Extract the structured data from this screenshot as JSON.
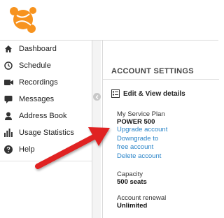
{
  "sidebar": {
    "items": [
      {
        "label": "Dashboard",
        "icon": "home-icon"
      },
      {
        "label": "Schedule",
        "icon": "clock-icon"
      },
      {
        "label": "Recordings",
        "icon": "video-camera-icon"
      },
      {
        "label": "Messages",
        "icon": "chat-bubble-icon"
      },
      {
        "label": "Address Book",
        "icon": "person-icon"
      },
      {
        "label": "Usage Statistics",
        "icon": "bar-chart-icon"
      },
      {
        "label": "Help",
        "icon": "question-icon"
      }
    ]
  },
  "main": {
    "section_title": "ACCOUNT SETTINGS",
    "edit_label": "Edit & View details",
    "service_plan": {
      "label": "My Service Plan",
      "value": "POWER 500",
      "links": {
        "upgrade": "Upgrade account",
        "downgrade_line1": "Downgrade to",
        "downgrade_line2": "free account",
        "delete": "Delete account"
      }
    },
    "capacity": {
      "label": "Capacity",
      "value": "500 seats"
    },
    "renewal": {
      "label": "Account renewal",
      "value": "Unlimited"
    }
  },
  "colors": {
    "brand_orange": "#f7931e",
    "link_blue": "#2a84c8",
    "arrow_red": "#e02020"
  }
}
